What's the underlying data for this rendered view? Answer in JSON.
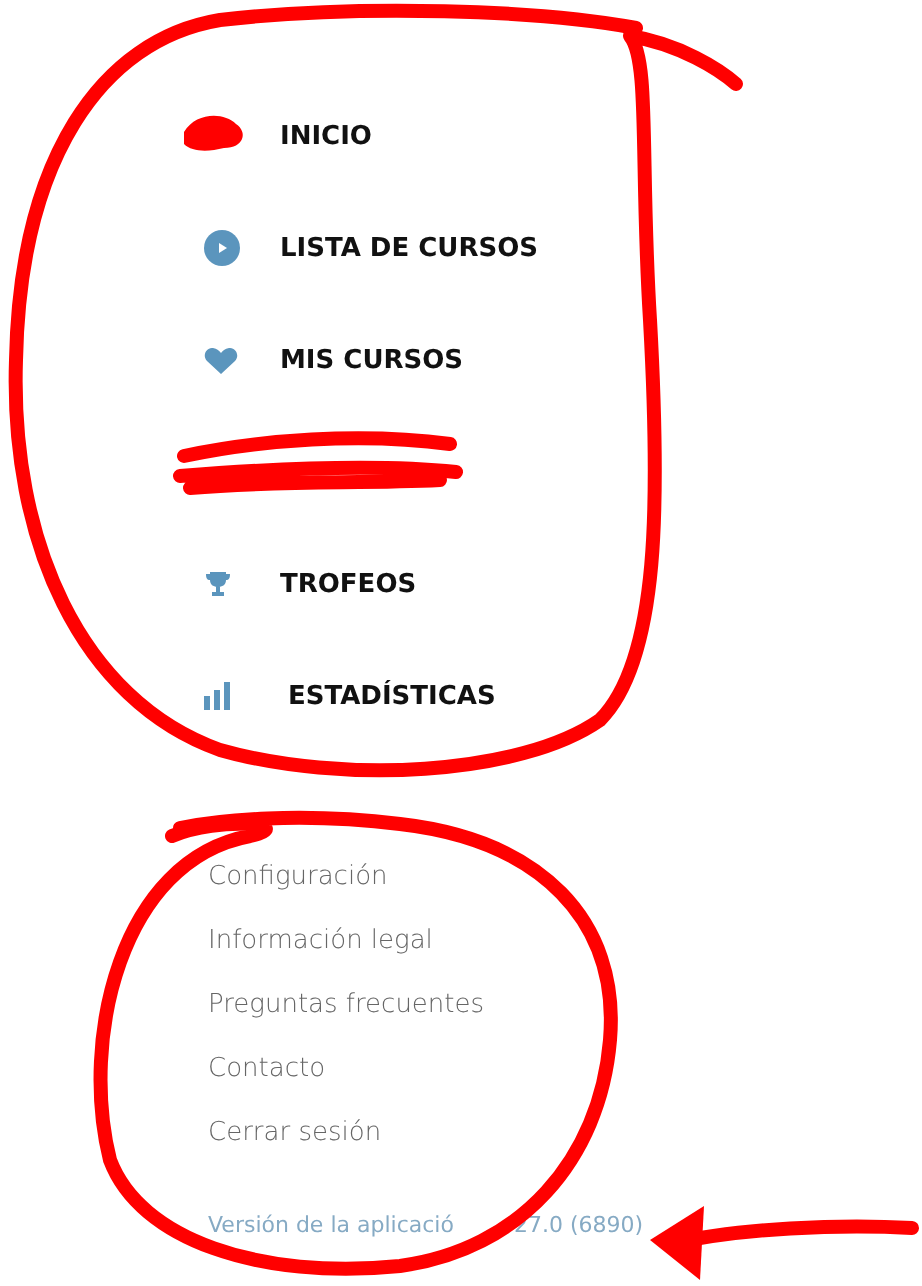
{
  "main_menu": [
    {
      "label": "INICIO"
    },
    {
      "label": "LISTA DE CURSOS",
      "kind": "play"
    },
    {
      "label": "MIS CURSOS",
      "kind": "heart"
    },
    {
      "kind": "redacted"
    },
    {
      "label": "TROFEOS",
      "kind": "trophy"
    },
    {
      "label": "ESTADÍSTICAS",
      "kind": "chart"
    }
  ],
  "secondary_menu": [
    "Configuración",
    "Información legal",
    "Preguntas frecuentes",
    "Contacto",
    "Cerrar sesión"
  ],
  "version": {
    "start": "Versión de la aplicació",
    "end": "27.0 (6890)"
  }
}
